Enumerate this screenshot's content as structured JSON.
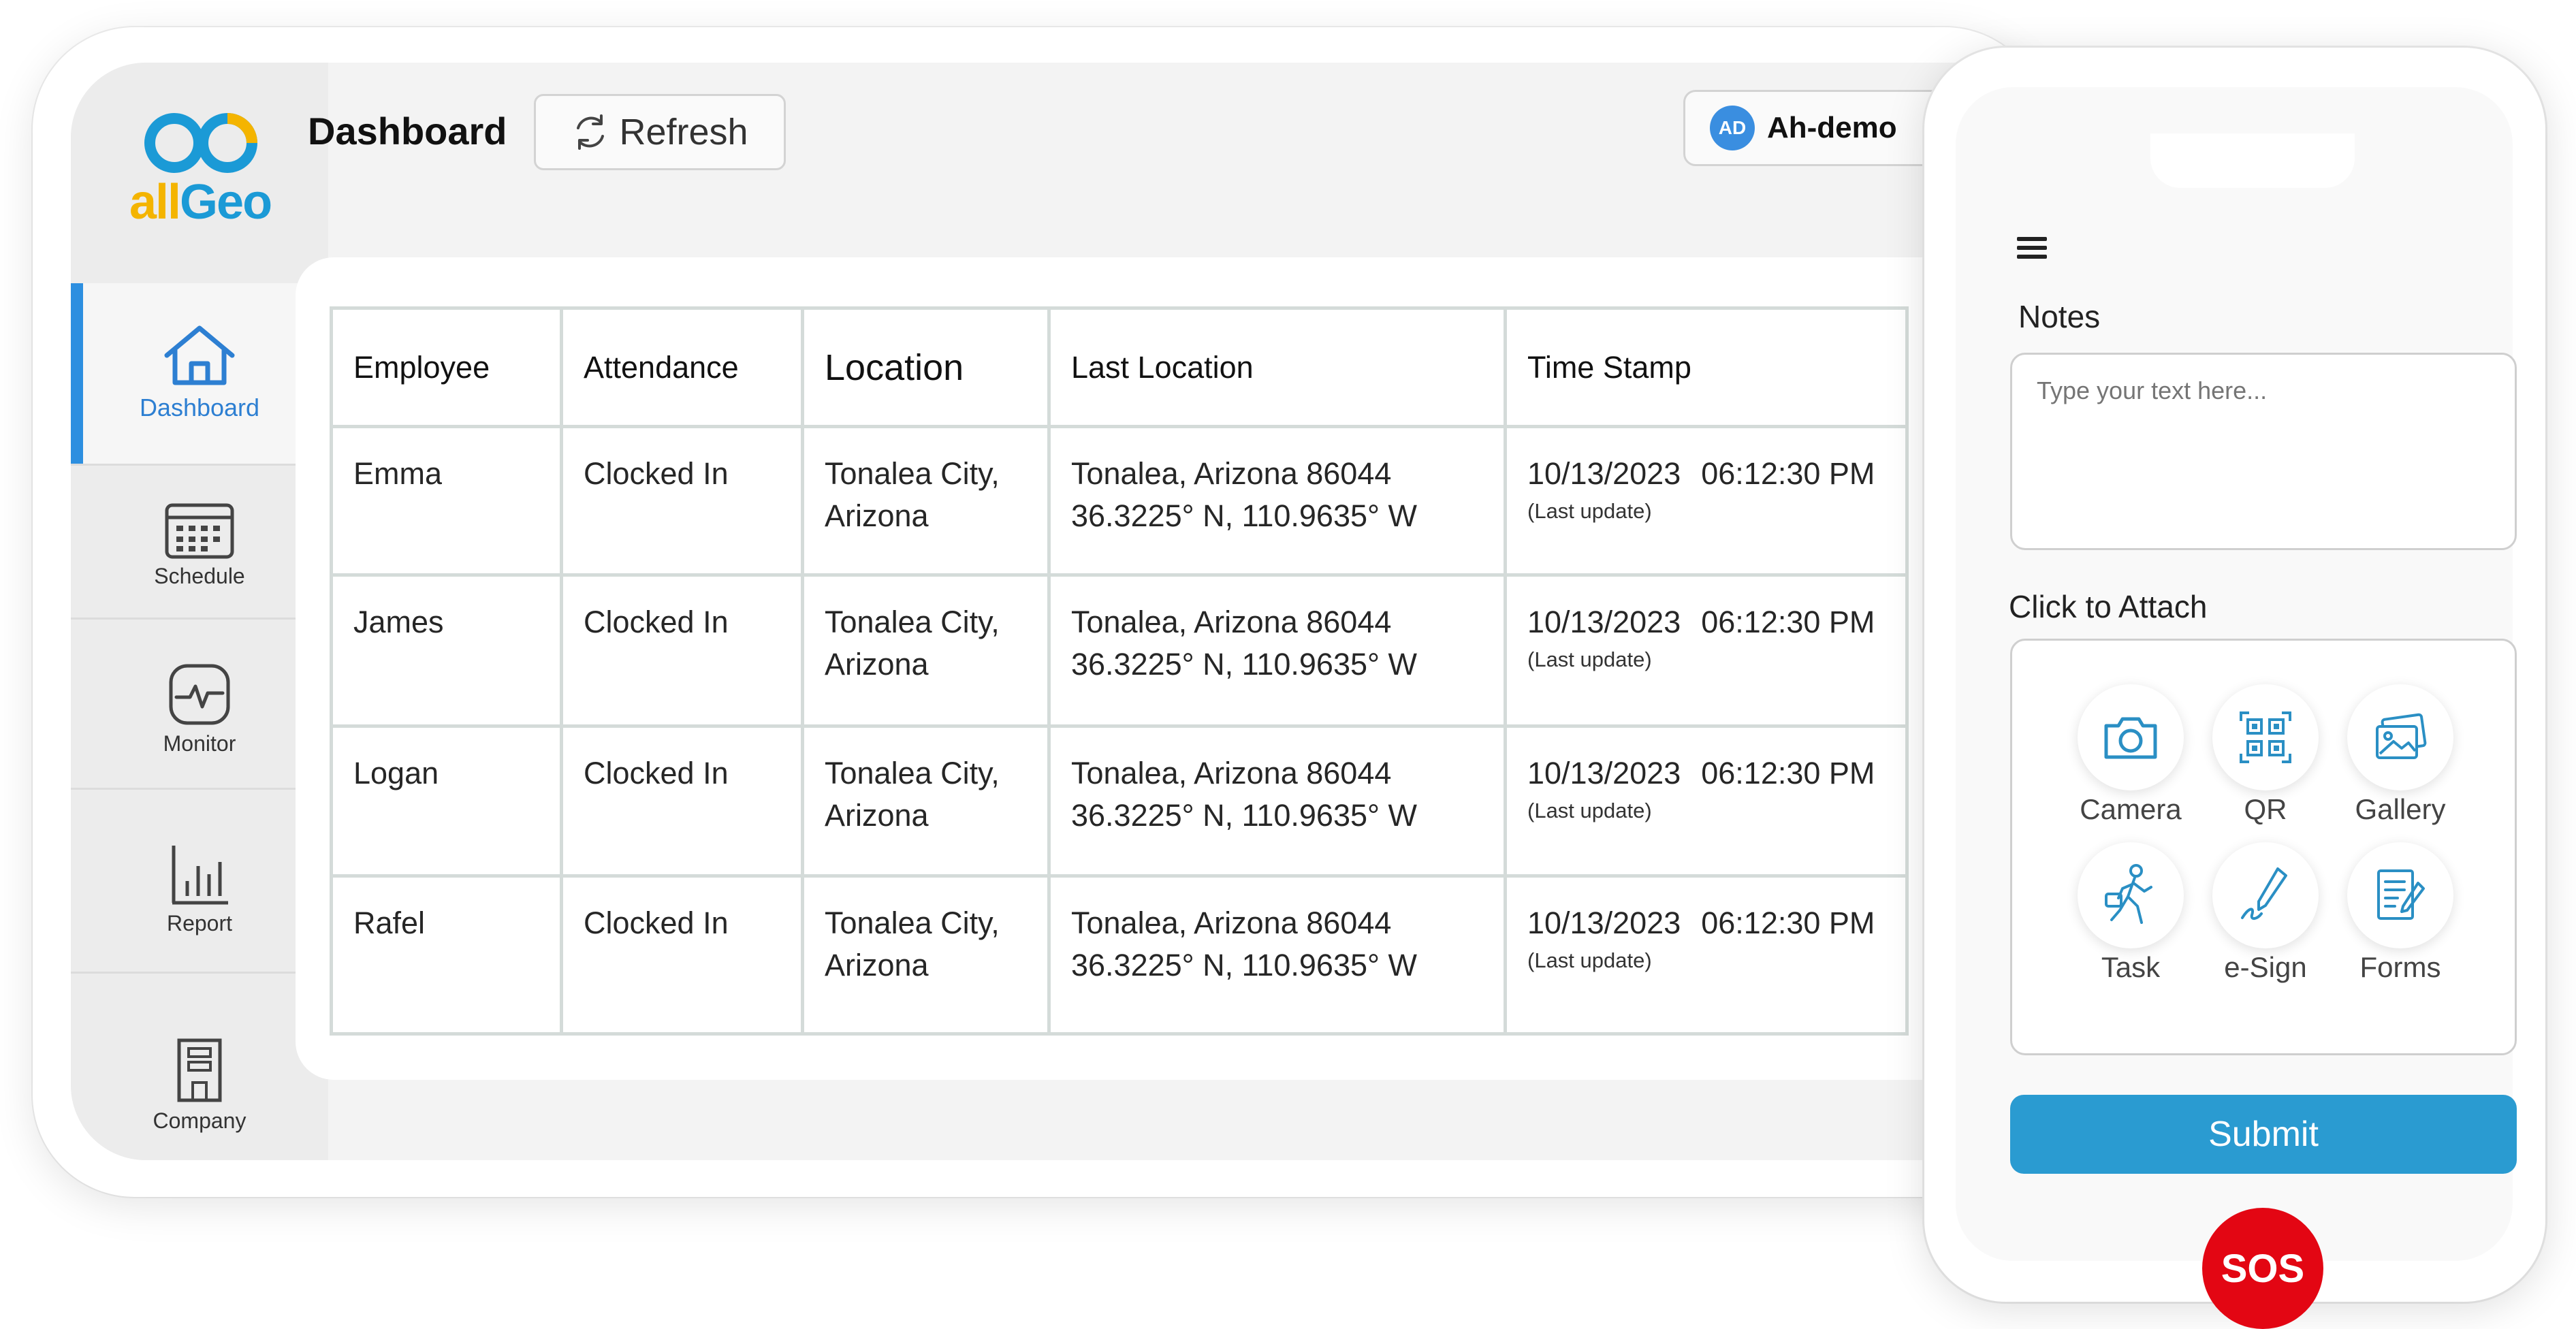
{
  "brand": {
    "logo_text_a": "all",
    "logo_text_b": "Geo"
  },
  "sidebar": {
    "items": [
      {
        "label": "Dashboard",
        "active": true
      },
      {
        "label": "Schedule"
      },
      {
        "label": "Monitor"
      },
      {
        "label": "Report"
      },
      {
        "label": "Company"
      }
    ]
  },
  "header": {
    "title": "Dashboard",
    "refresh_label": "Refresh",
    "user_initials": "AD",
    "user_name": "Ah-demo"
  },
  "table": {
    "columns": [
      "Employee",
      "Attendance",
      "Location",
      "Last Location",
      "Time Stamp"
    ],
    "rows": [
      {
        "employee": "Emma",
        "attendance": "Clocked In",
        "location_line1": "Tonalea City,",
        "location_line2": "Arizona",
        "last_location_line1": "Tonalea, Arizona 86044",
        "last_location_line2": "36.3225° N, 110.9635° W",
        "date": "10/13/2023",
        "time": "06:12:30 PM",
        "note": "(Last update)"
      },
      {
        "employee": "James",
        "attendance": "Clocked In",
        "location_line1": "Tonalea City,",
        "location_line2": "Arizona",
        "last_location_line1": "Tonalea, Arizona 86044",
        "last_location_line2": "36.3225° N, 110.9635° W",
        "date": "10/13/2023",
        "time": "06:12:30 PM",
        "note": "(Last update)"
      },
      {
        "employee": "Logan",
        "attendance": "Clocked In",
        "location_line1": "Tonalea City,",
        "location_line2": "Arizona",
        "last_location_line1": "Tonalea, Arizona 86044",
        "last_location_line2": "36.3225° N, 110.9635° W",
        "date": "10/13/2023",
        "time": "06:12:30 PM",
        "note": "(Last update)"
      },
      {
        "employee": "Rafel",
        "attendance": "Clocked In",
        "location_line1": "Tonalea City,",
        "location_line2": "Arizona",
        "last_location_line1": "Tonalea, Arizona 86044",
        "last_location_line2": "36.3225° N, 110.9635° W",
        "date": "10/13/2023",
        "time": "06:12:30 PM",
        "note": "(Last update)"
      }
    ]
  },
  "phone": {
    "notes_label": "Notes",
    "notes_placeholder": "Type your text here...",
    "attach_label": "Click to Attach",
    "attach_items": [
      {
        "label": "Camera",
        "icon": "camera-icon"
      },
      {
        "label": "QR",
        "icon": "qr-code-icon"
      },
      {
        "label": "Gallery",
        "icon": "gallery-icon"
      },
      {
        "label": "Task",
        "icon": "task-icon"
      },
      {
        "label": "e-Sign",
        "icon": "e-sign-icon"
      },
      {
        "label": "Forms",
        "icon": "forms-icon"
      }
    ],
    "submit_label": "Submit",
    "sos_label": "SOS"
  },
  "colors": {
    "accent_blue": "#2d8fe0",
    "submit_blue": "#2a9bd1",
    "sos_red": "#e30613",
    "logo_yellow": "#f4b400",
    "logo_blue": "#1b9ad6"
  }
}
